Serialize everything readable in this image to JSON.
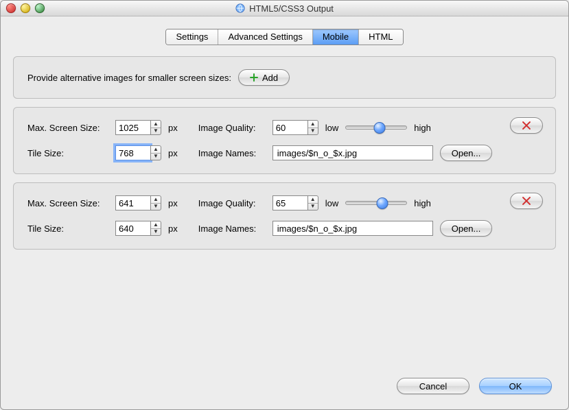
{
  "window": {
    "title": "HTML5/CSS3 Output"
  },
  "tabs": {
    "items": [
      "Settings",
      "Advanced Settings",
      "Mobile",
      "HTML"
    ],
    "activeIndex": 2
  },
  "header_panel": {
    "prompt": "Provide alternative images for smaller screen sizes:",
    "add_label": "Add"
  },
  "labels": {
    "max_screen_size": "Max. Screen Size:",
    "tile_size": "Tile Size:",
    "image_quality": "Image Quality:",
    "image_names": "Image Names:",
    "px": "px",
    "low": "low",
    "high": "high",
    "open": "Open..."
  },
  "groups": [
    {
      "max_screen_size": "1025",
      "tile_size": "768",
      "tile_size_focused": true,
      "image_quality": "60",
      "slider_pos_pct": 55,
      "image_names": "images/$n_o_$x.jpg"
    },
    {
      "max_screen_size": "641",
      "tile_size": "640",
      "tile_size_focused": false,
      "image_quality": "65",
      "slider_pos_pct": 60,
      "image_names": "images/$n_o_$x.jpg"
    }
  ],
  "footer": {
    "cancel": "Cancel",
    "ok": "OK"
  }
}
